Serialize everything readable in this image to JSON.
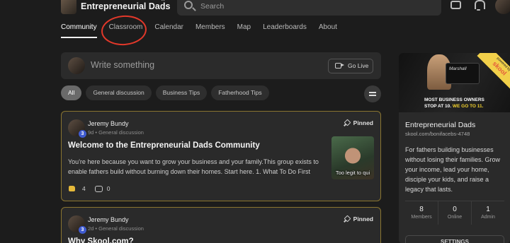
{
  "header": {
    "group_name": "Entrepreneurial Dads",
    "search_placeholder": "Search"
  },
  "tabs": [
    {
      "label": "Community",
      "active": true
    },
    {
      "label": "Classroom"
    },
    {
      "label": "Calendar"
    },
    {
      "label": "Members"
    },
    {
      "label": "Map"
    },
    {
      "label": "Leaderboards"
    },
    {
      "label": "About"
    }
  ],
  "composer": {
    "placeholder": "Write something",
    "go_live_label": "Go Live"
  },
  "filters": [
    "All",
    "General discussion",
    "Business Tips",
    "Fatherhood Tips"
  ],
  "posts": [
    {
      "author": "Jeremy Bundy",
      "level": "3",
      "meta": "9d • General discussion",
      "pinned_label": "Pinned",
      "title": "Welcome to the Entrepreneurial Dads Community",
      "body": "You're here because you want to grow your business and your family.This group exists to enable fathers build without burning down their homes. Start here. 1. What To Do First",
      "thumb_caption": "Too legit to qui",
      "likes": "4",
      "comments": "0"
    },
    {
      "author": "Jeremy Bundy",
      "level": "3",
      "meta": "2d • General discussion",
      "pinned_label": "Pinned",
      "title": "Why Skool.com?"
    }
  ],
  "group_card": {
    "banner_line1": "MOST BUSINESS OWNERS",
    "banner_line2_prefix": "STOP AT 10.",
    "banner_line2_accent": "WE GO TO 11.",
    "amp_brand": "Marshall",
    "ribbon_small": "powered by",
    "ribbon_brand": "skool",
    "title": "Entrepreneurial Dads",
    "url": "skool.com/bonifacebs-4748",
    "description": "For fathers building businesses without losing their families. Grow your income, lead your home, disciple your kids, and raise a legacy that lasts.",
    "stats": [
      {
        "value": "8",
        "label": "Members"
      },
      {
        "value": "0",
        "label": "Online"
      },
      {
        "value": "1",
        "label": "Admin"
      }
    ],
    "settings_label": "SETTINGS"
  },
  "colors": {
    "background": "#1c1c1c",
    "pinned_border": "#8a7530",
    "annotation_circle": "#e2382a",
    "level_badge": "#3f5bd0",
    "ribbon": "#f2d04a"
  }
}
